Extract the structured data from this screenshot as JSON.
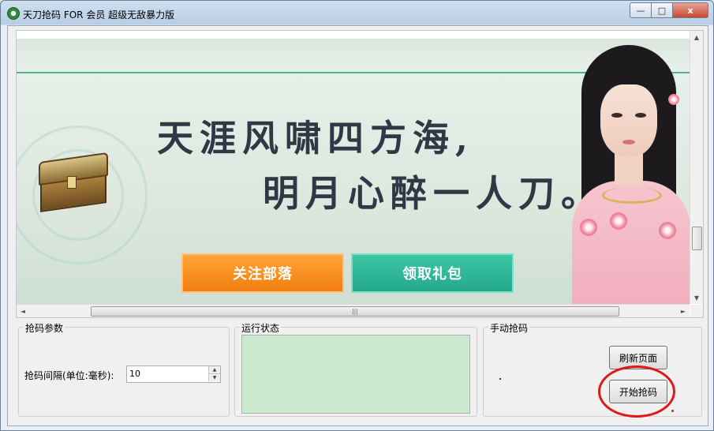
{
  "window": {
    "title": "天刀抢码 FOR 会员 超级无敌暴力版",
    "minimize_glyph": "—",
    "maximize_glyph": "□",
    "close_glyph": "x"
  },
  "banner": {
    "slogan_line1": "天涯风啸四方海,",
    "slogan_line2": "明月心醉一人刀。",
    "follow_button": "关注部落",
    "gift_button": "领取礼包"
  },
  "scrollbars": {
    "up_arrow": "▲",
    "down_arrow": "▼",
    "left_arrow": "◄",
    "right_arrow": "►",
    "thumb_grip": "|||"
  },
  "params": {
    "group_title": "抢码参数",
    "interval_label": "抢码间隔(单位:毫秒):",
    "interval_value": "10"
  },
  "status": {
    "group_title": "运行状态"
  },
  "manual": {
    "group_title": "手动抢码",
    "refresh_button": "刷新页面",
    "start_button": "开始抢码"
  },
  "colors": {
    "orange_button": "#f08a1c",
    "teal_button": "#2bb697",
    "status_box": "#cce8cf",
    "highlight": "#e01818"
  }
}
